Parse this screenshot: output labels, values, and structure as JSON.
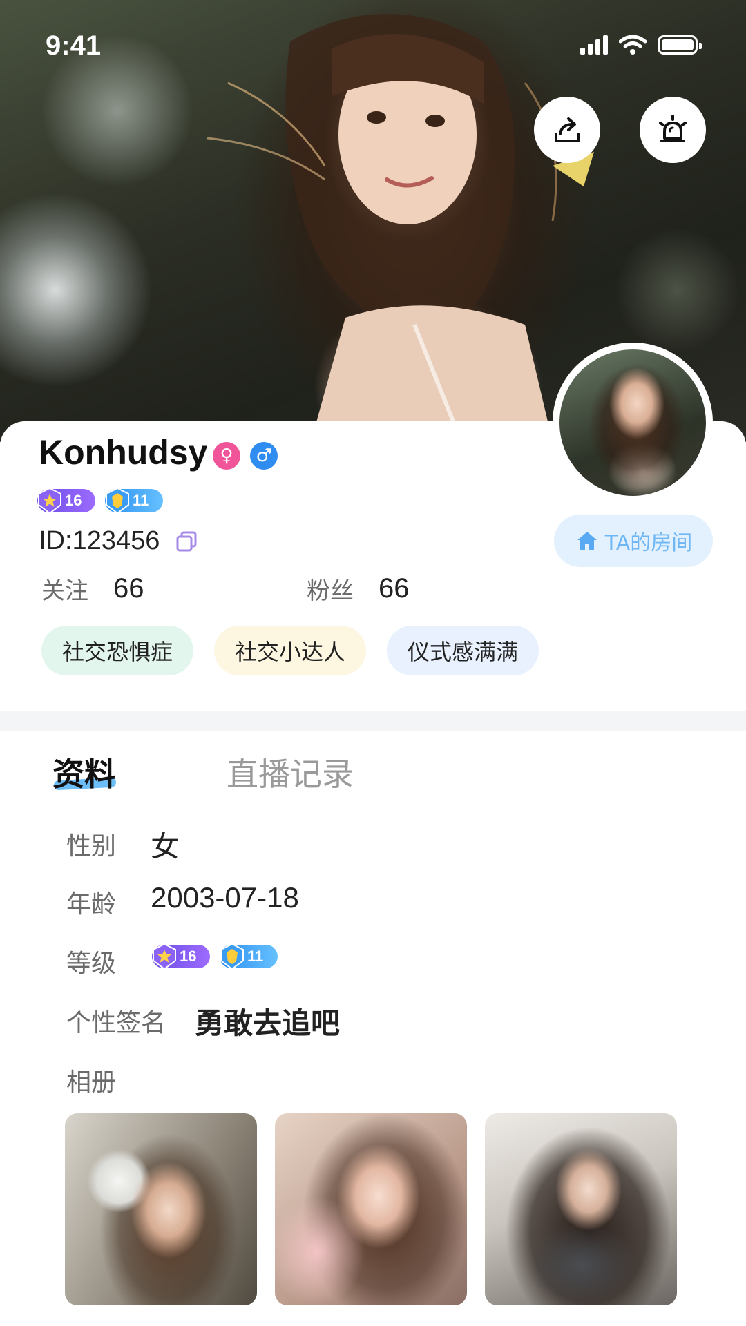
{
  "status_bar": {
    "time": "9:41"
  },
  "profile": {
    "username": "Konhudsy",
    "gender_female_symbol": "♀",
    "gender_male_symbol": "♂",
    "levels": [
      {
        "value": "16",
        "color": "#7a55ee"
      },
      {
        "value": "11",
        "color": "#3a9cf2"
      }
    ],
    "id_text": "ID:123456",
    "room_button": "TA的房间",
    "stats": {
      "follow_label": "关注",
      "follow_value": "66",
      "fans_label": "粉丝",
      "fans_value": "66"
    },
    "tags": [
      "社交恐惧症",
      "社交小达人",
      "仪式感满满"
    ]
  },
  "tabs": [
    {
      "label": "资料",
      "active": true
    },
    {
      "label": "直播记录",
      "active": false
    }
  ],
  "info": {
    "gender_label": "性别",
    "gender_value": "女",
    "age_label": "年龄",
    "age_value": "2003-07-18",
    "level_label": "等级",
    "signature_label": "个性签名",
    "signature_value": "勇敢去追吧",
    "album_label": "相册"
  },
  "album_photo_count": 3,
  "colors": {
    "accent_blue": "#5db7f5",
    "room_button_bg": "#e3f1ff",
    "tag_green": "#e3f6ee",
    "tag_yellow": "#fdf6e1",
    "tag_blue": "#e8f1fd"
  },
  "icons": [
    "share-icon",
    "alarm-light-icon",
    "copy-icon",
    "home-icon",
    "signal-icon",
    "wifi-icon",
    "battery-icon"
  ]
}
